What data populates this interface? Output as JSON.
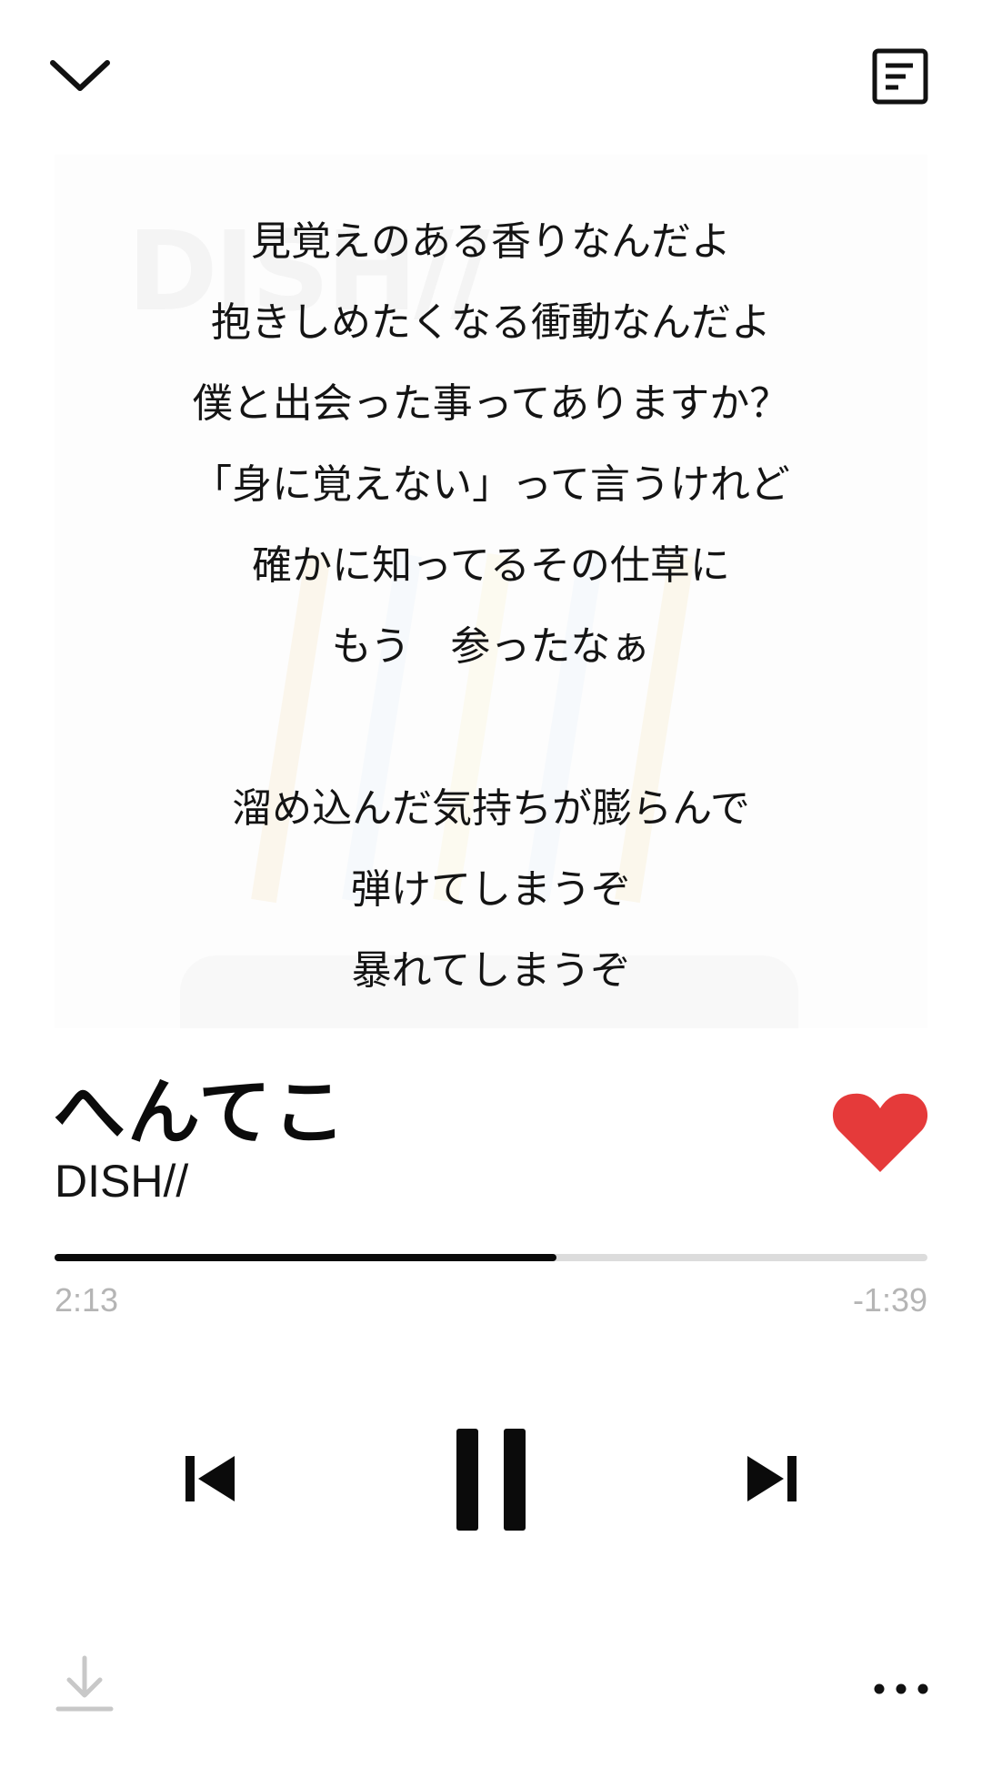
{
  "header": {
    "collapse_icon": "chevron-down-icon",
    "lyrics_icon": "lyrics-document-icon"
  },
  "artwork": {
    "watermark_text": "DISH//"
  },
  "lyrics": [
    "見覚えのある香りなんだよ",
    "抱きしめたくなる衝動なんだよ",
    "僕と出会った事ってありますか？",
    "「身に覚えない」って言うけれど",
    "確かに知ってるその仕草に",
    "もう　参ったなぁ",
    "",
    "溜め込んだ気持ちが膨らんで",
    "弾けてしまうぞ",
    "暴れてしまうぞ"
  ],
  "track": {
    "title": "へんてこ",
    "artist": "DISH//",
    "liked": true,
    "like_color": "#e53a3a"
  },
  "playback": {
    "elapsed": "2:13",
    "remaining": "-1:39",
    "progress_fraction": 0.575
  },
  "controls": {
    "prev_icon": "skip-previous-icon",
    "pause_icon": "pause-icon",
    "next_icon": "skip-next-icon"
  },
  "footer": {
    "download_icon": "download-icon",
    "more_icon": "more-dots-icon"
  }
}
